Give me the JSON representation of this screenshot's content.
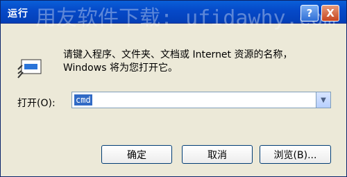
{
  "window": {
    "title": "运行",
    "watermark": "用友软件下载: ufidawhy.com",
    "help_label": "?",
    "close_label": "X"
  },
  "dialog": {
    "description": "请键入程序、文件夹、文档或 Internet 资源的名称，Windows 将为您打开它。",
    "open_label": "打开(O):",
    "input_value": "cmd",
    "ok_label": "确定",
    "cancel_label": "取消",
    "browse_label": "浏览(B)..."
  },
  "icons": {
    "run": "run-icon",
    "help": "help-icon",
    "close": "close-icon",
    "dropdown": "chevron-down-icon"
  },
  "colors": {
    "titlebar": "#0549c8",
    "selection": "#316ac5",
    "dialog_bg": "#ece9d8"
  }
}
